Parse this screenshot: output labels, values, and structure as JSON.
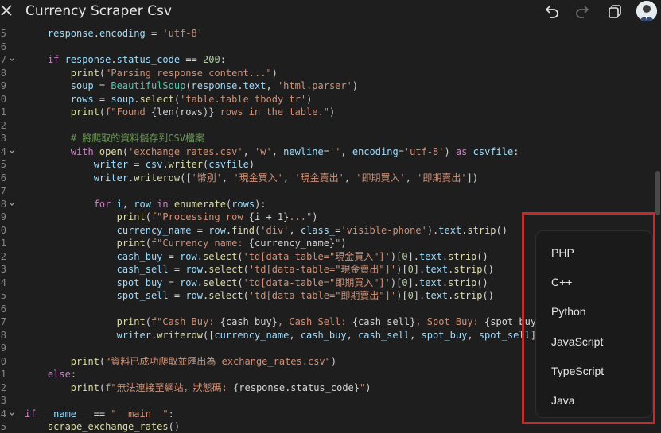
{
  "header": {
    "title": "Currency Scraper Csv",
    "icons": [
      "close-icon",
      "undo-icon",
      "redo-icon",
      "copy-icon",
      "avatar"
    ]
  },
  "code_lines": [
    {
      "num": "5",
      "fold": false,
      "tokens": [
        [
          "    ",
          "op"
        ],
        [
          "response",
          "var"
        ],
        [
          ".",
          "op"
        ],
        [
          "encoding",
          "var"
        ],
        [
          " = ",
          "op"
        ],
        [
          "'utf-8'",
          "str"
        ]
      ]
    },
    {
      "num": "6",
      "fold": false,
      "tokens": []
    },
    {
      "num": "7",
      "fold": true,
      "tokens": [
        [
          "    ",
          "op"
        ],
        [
          "if ",
          "kw"
        ],
        [
          "response",
          "var"
        ],
        [
          ".",
          "op"
        ],
        [
          "status_code",
          "var"
        ],
        [
          " == ",
          "op"
        ],
        [
          "200",
          "num"
        ],
        [
          ":",
          "op"
        ]
      ]
    },
    {
      "num": "8",
      "fold": false,
      "tokens": [
        [
          "        ",
          "op"
        ],
        [
          "print",
          "fn"
        ],
        [
          "(",
          "op"
        ],
        [
          "\"Parsing response content...\"",
          "str"
        ],
        [
          ")",
          "op"
        ]
      ]
    },
    {
      "num": "9",
      "fold": false,
      "tokens": [
        [
          "        ",
          "op"
        ],
        [
          "soup",
          "var"
        ],
        [
          " = ",
          "op"
        ],
        [
          "BeautifulSoup",
          "cls"
        ],
        [
          "(",
          "op"
        ],
        [
          "response",
          "var"
        ],
        [
          ".",
          "op"
        ],
        [
          "text",
          "var"
        ],
        [
          ", ",
          "op"
        ],
        [
          "'html.parser'",
          "str"
        ],
        [
          ")",
          "op"
        ]
      ]
    },
    {
      "num": "0",
      "fold": false,
      "tokens": [
        [
          "        ",
          "op"
        ],
        [
          "rows",
          "var"
        ],
        [
          " = ",
          "op"
        ],
        [
          "soup",
          "var"
        ],
        [
          ".",
          "op"
        ],
        [
          "select",
          "fn"
        ],
        [
          "(",
          "op"
        ],
        [
          "'table.table tbody tr'",
          "str"
        ],
        [
          ")",
          "op"
        ]
      ]
    },
    {
      "num": "1",
      "fold": false,
      "tokens": [
        [
          "        ",
          "op"
        ],
        [
          "print",
          "fn"
        ],
        [
          "(",
          "op"
        ],
        [
          "f\"Found ",
          "str"
        ],
        [
          "{len(rows)}",
          "op"
        ],
        [
          " rows in the table.\"",
          "str"
        ],
        [
          ")",
          "op"
        ]
      ]
    },
    {
      "num": "2",
      "fold": false,
      "tokens": []
    },
    {
      "num": "3",
      "fold": false,
      "tokens": [
        [
          "        ",
          "op"
        ],
        [
          "# 將爬取的資料儲存到CSV檔案",
          "cm"
        ]
      ]
    },
    {
      "num": "4",
      "fold": true,
      "tokens": [
        [
          "        ",
          "op"
        ],
        [
          "with ",
          "kw"
        ],
        [
          "open",
          "fn"
        ],
        [
          "(",
          "op"
        ],
        [
          "'exchange_rates.csv'",
          "str"
        ],
        [
          ", ",
          "op"
        ],
        [
          "'w'",
          "str"
        ],
        [
          ", ",
          "op"
        ],
        [
          "newline",
          "var"
        ],
        [
          "=",
          "op"
        ],
        [
          "''",
          "str"
        ],
        [
          ", ",
          "op"
        ],
        [
          "encoding",
          "var"
        ],
        [
          "=",
          "op"
        ],
        [
          "'utf-8'",
          "str"
        ],
        [
          ") ",
          "op"
        ],
        [
          "as ",
          "kw"
        ],
        [
          "csvfile",
          "var"
        ],
        [
          ":",
          "op"
        ]
      ]
    },
    {
      "num": "5",
      "fold": false,
      "tokens": [
        [
          "            ",
          "op"
        ],
        [
          "writer",
          "var"
        ],
        [
          " = ",
          "op"
        ],
        [
          "csv",
          "var"
        ],
        [
          ".",
          "op"
        ],
        [
          "writer",
          "fn"
        ],
        [
          "(",
          "op"
        ],
        [
          "csvfile",
          "var"
        ],
        [
          ")",
          "op"
        ]
      ]
    },
    {
      "num": "6",
      "fold": false,
      "tokens": [
        [
          "            ",
          "op"
        ],
        [
          "writer",
          "var"
        ],
        [
          ".",
          "op"
        ],
        [
          "writerow",
          "fn"
        ],
        [
          "([",
          "op"
        ],
        [
          "'幣別'",
          "str"
        ],
        [
          ", ",
          "op"
        ],
        [
          "'現金買入'",
          "str"
        ],
        [
          ", ",
          "op"
        ],
        [
          "'現金賣出'",
          "str"
        ],
        [
          ", ",
          "op"
        ],
        [
          "'即期買入'",
          "str"
        ],
        [
          ", ",
          "op"
        ],
        [
          "'即期賣出'",
          "str"
        ],
        [
          "])",
          "op"
        ]
      ]
    },
    {
      "num": "7",
      "fold": false,
      "tokens": []
    },
    {
      "num": "8",
      "fold": true,
      "tokens": [
        [
          "            ",
          "op"
        ],
        [
          "for ",
          "kw"
        ],
        [
          "i",
          "var"
        ],
        [
          ", ",
          "op"
        ],
        [
          "row ",
          "var"
        ],
        [
          "in ",
          "kw"
        ],
        [
          "enumerate",
          "fn"
        ],
        [
          "(",
          "op"
        ],
        [
          "rows",
          "var"
        ],
        [
          "):",
          "op"
        ]
      ]
    },
    {
      "num": "9",
      "fold": false,
      "tokens": [
        [
          "                ",
          "op"
        ],
        [
          "print",
          "fn"
        ],
        [
          "(",
          "op"
        ],
        [
          "f\"Processing row ",
          "str"
        ],
        [
          "{i + 1}",
          "op"
        ],
        [
          "...\"",
          "str"
        ],
        [
          ")",
          "op"
        ]
      ]
    },
    {
      "num": "0",
      "fold": false,
      "tokens": [
        [
          "                ",
          "op"
        ],
        [
          "currency_name",
          "var"
        ],
        [
          " = ",
          "op"
        ],
        [
          "row",
          "var"
        ],
        [
          ".",
          "op"
        ],
        [
          "find",
          "fn"
        ],
        [
          "(",
          "op"
        ],
        [
          "'div'",
          "str"
        ],
        [
          ", ",
          "op"
        ],
        [
          "class_",
          "var"
        ],
        [
          "=",
          "op"
        ],
        [
          "'visible-phone'",
          "str"
        ],
        [
          ").",
          "op"
        ],
        [
          "text",
          "var"
        ],
        [
          ".",
          "op"
        ],
        [
          "strip",
          "fn"
        ],
        [
          "()",
          "op"
        ]
      ]
    },
    {
      "num": "1",
      "fold": false,
      "tokens": [
        [
          "                ",
          "op"
        ],
        [
          "print",
          "fn"
        ],
        [
          "(",
          "op"
        ],
        [
          "f\"Currency name: ",
          "str"
        ],
        [
          "{currency_name}",
          "op"
        ],
        [
          "\"",
          "str"
        ],
        [
          ")",
          "op"
        ]
      ]
    },
    {
      "num": "2",
      "fold": false,
      "tokens": [
        [
          "                ",
          "op"
        ],
        [
          "cash_buy",
          "var"
        ],
        [
          " = ",
          "op"
        ],
        [
          "row",
          "var"
        ],
        [
          ".",
          "op"
        ],
        [
          "select",
          "fn"
        ],
        [
          "(",
          "op"
        ],
        [
          "'td[data-table=\"現金買入\"]'",
          "str"
        ],
        [
          ")[",
          "op"
        ],
        [
          "0",
          "num"
        ],
        [
          "].",
          "op"
        ],
        [
          "text",
          "var"
        ],
        [
          ".",
          "op"
        ],
        [
          "strip",
          "fn"
        ],
        [
          "()",
          "op"
        ]
      ]
    },
    {
      "num": "3",
      "fold": false,
      "tokens": [
        [
          "                ",
          "op"
        ],
        [
          "cash_sell",
          "var"
        ],
        [
          " = ",
          "op"
        ],
        [
          "row",
          "var"
        ],
        [
          ".",
          "op"
        ],
        [
          "select",
          "fn"
        ],
        [
          "(",
          "op"
        ],
        [
          "'td[data-table=\"現金賣出\"]'",
          "str"
        ],
        [
          ")[",
          "op"
        ],
        [
          "0",
          "num"
        ],
        [
          "].",
          "op"
        ],
        [
          "text",
          "var"
        ],
        [
          ".",
          "op"
        ],
        [
          "strip",
          "fn"
        ],
        [
          "()",
          "op"
        ]
      ]
    },
    {
      "num": "4",
      "fold": false,
      "tokens": [
        [
          "                ",
          "op"
        ],
        [
          "spot_buy",
          "var"
        ],
        [
          " = ",
          "op"
        ],
        [
          "row",
          "var"
        ],
        [
          ".",
          "op"
        ],
        [
          "select",
          "fn"
        ],
        [
          "(",
          "op"
        ],
        [
          "'td[data-table=\"即期買入\"]'",
          "str"
        ],
        [
          ")[",
          "op"
        ],
        [
          "0",
          "num"
        ],
        [
          "].",
          "op"
        ],
        [
          "text",
          "var"
        ],
        [
          ".",
          "op"
        ],
        [
          "strip",
          "fn"
        ],
        [
          "()",
          "op"
        ]
      ]
    },
    {
      "num": "5",
      "fold": false,
      "tokens": [
        [
          "                ",
          "op"
        ],
        [
          "spot_sell",
          "var"
        ],
        [
          " = ",
          "op"
        ],
        [
          "row",
          "var"
        ],
        [
          ".",
          "op"
        ],
        [
          "select",
          "fn"
        ],
        [
          "(",
          "op"
        ],
        [
          "'td[data-table=\"即期賣出\"]'",
          "str"
        ],
        [
          ")[",
          "op"
        ],
        [
          "0",
          "num"
        ],
        [
          "].",
          "op"
        ],
        [
          "text",
          "var"
        ],
        [
          ".",
          "op"
        ],
        [
          "strip",
          "fn"
        ],
        [
          "()",
          "op"
        ]
      ]
    },
    {
      "num": "6",
      "fold": false,
      "tokens": []
    },
    {
      "num": "7",
      "fold": false,
      "tokens": [
        [
          "                ",
          "op"
        ],
        [
          "print",
          "fn"
        ],
        [
          "(",
          "op"
        ],
        [
          "f\"Cash Buy: ",
          "str"
        ],
        [
          "{cash_buy}",
          "op"
        ],
        [
          ", Cash Sell: ",
          "str"
        ],
        [
          "{cash_sell}",
          "op"
        ],
        [
          ", Spot Buy: ",
          "str"
        ],
        [
          "{spot_buy}",
          "op"
        ],
        [
          ", Spot S",
          "str"
        ]
      ]
    },
    {
      "num": "8",
      "fold": false,
      "tokens": [
        [
          "                ",
          "op"
        ],
        [
          "writer",
          "var"
        ],
        [
          ".",
          "op"
        ],
        [
          "writerow",
          "fn"
        ],
        [
          "([",
          "op"
        ],
        [
          "currency_name",
          "var"
        ],
        [
          ", ",
          "op"
        ],
        [
          "cash_buy",
          "var"
        ],
        [
          ", ",
          "op"
        ],
        [
          "cash_sell",
          "var"
        ],
        [
          ", ",
          "op"
        ],
        [
          "spot_buy",
          "var"
        ],
        [
          ", ",
          "op"
        ],
        [
          "spot_sell",
          "var"
        ],
        [
          "])",
          "op"
        ]
      ]
    },
    {
      "num": "9",
      "fold": false,
      "tokens": []
    },
    {
      "num": "0",
      "fold": false,
      "tokens": [
        [
          "        ",
          "op"
        ],
        [
          "print",
          "fn"
        ],
        [
          "(",
          "op"
        ],
        [
          "\"資料已成功爬取並匯出為 exchange_rates.csv\"",
          "str"
        ],
        [
          ")",
          "op"
        ]
      ]
    },
    {
      "num": "1",
      "fold": false,
      "tokens": [
        [
          "    ",
          "op"
        ],
        [
          "else",
          "kw"
        ],
        [
          ":",
          "op"
        ]
      ]
    },
    {
      "num": "2",
      "fold": false,
      "tokens": [
        [
          "        ",
          "op"
        ],
        [
          "print",
          "fn"
        ],
        [
          "(",
          "op"
        ],
        [
          "f\"無法連接至網站，狀態碼: ",
          "str"
        ],
        [
          "{response.status_code}",
          "op"
        ],
        [
          "\"",
          "str"
        ],
        [
          ")",
          "op"
        ]
      ]
    },
    {
      "num": "3",
      "fold": false,
      "tokens": []
    },
    {
      "num": "4",
      "fold": true,
      "tokens": [
        [
          "if ",
          "kw"
        ],
        [
          "__name__",
          "dunder"
        ],
        [
          " == ",
          "op"
        ],
        [
          "\"__main__\"",
          "str"
        ],
        [
          ":",
          "op"
        ]
      ]
    },
    {
      "num": "5",
      "fold": false,
      "tokens": [
        [
          "    ",
          "op"
        ],
        [
          "scrape_exchange_rates",
          "fn"
        ],
        [
          "()",
          "op"
        ]
      ]
    }
  ],
  "language_menu": {
    "items": [
      "PHP",
      "C++",
      "Python",
      "JavaScript",
      "TypeScript",
      "Java"
    ]
  }
}
